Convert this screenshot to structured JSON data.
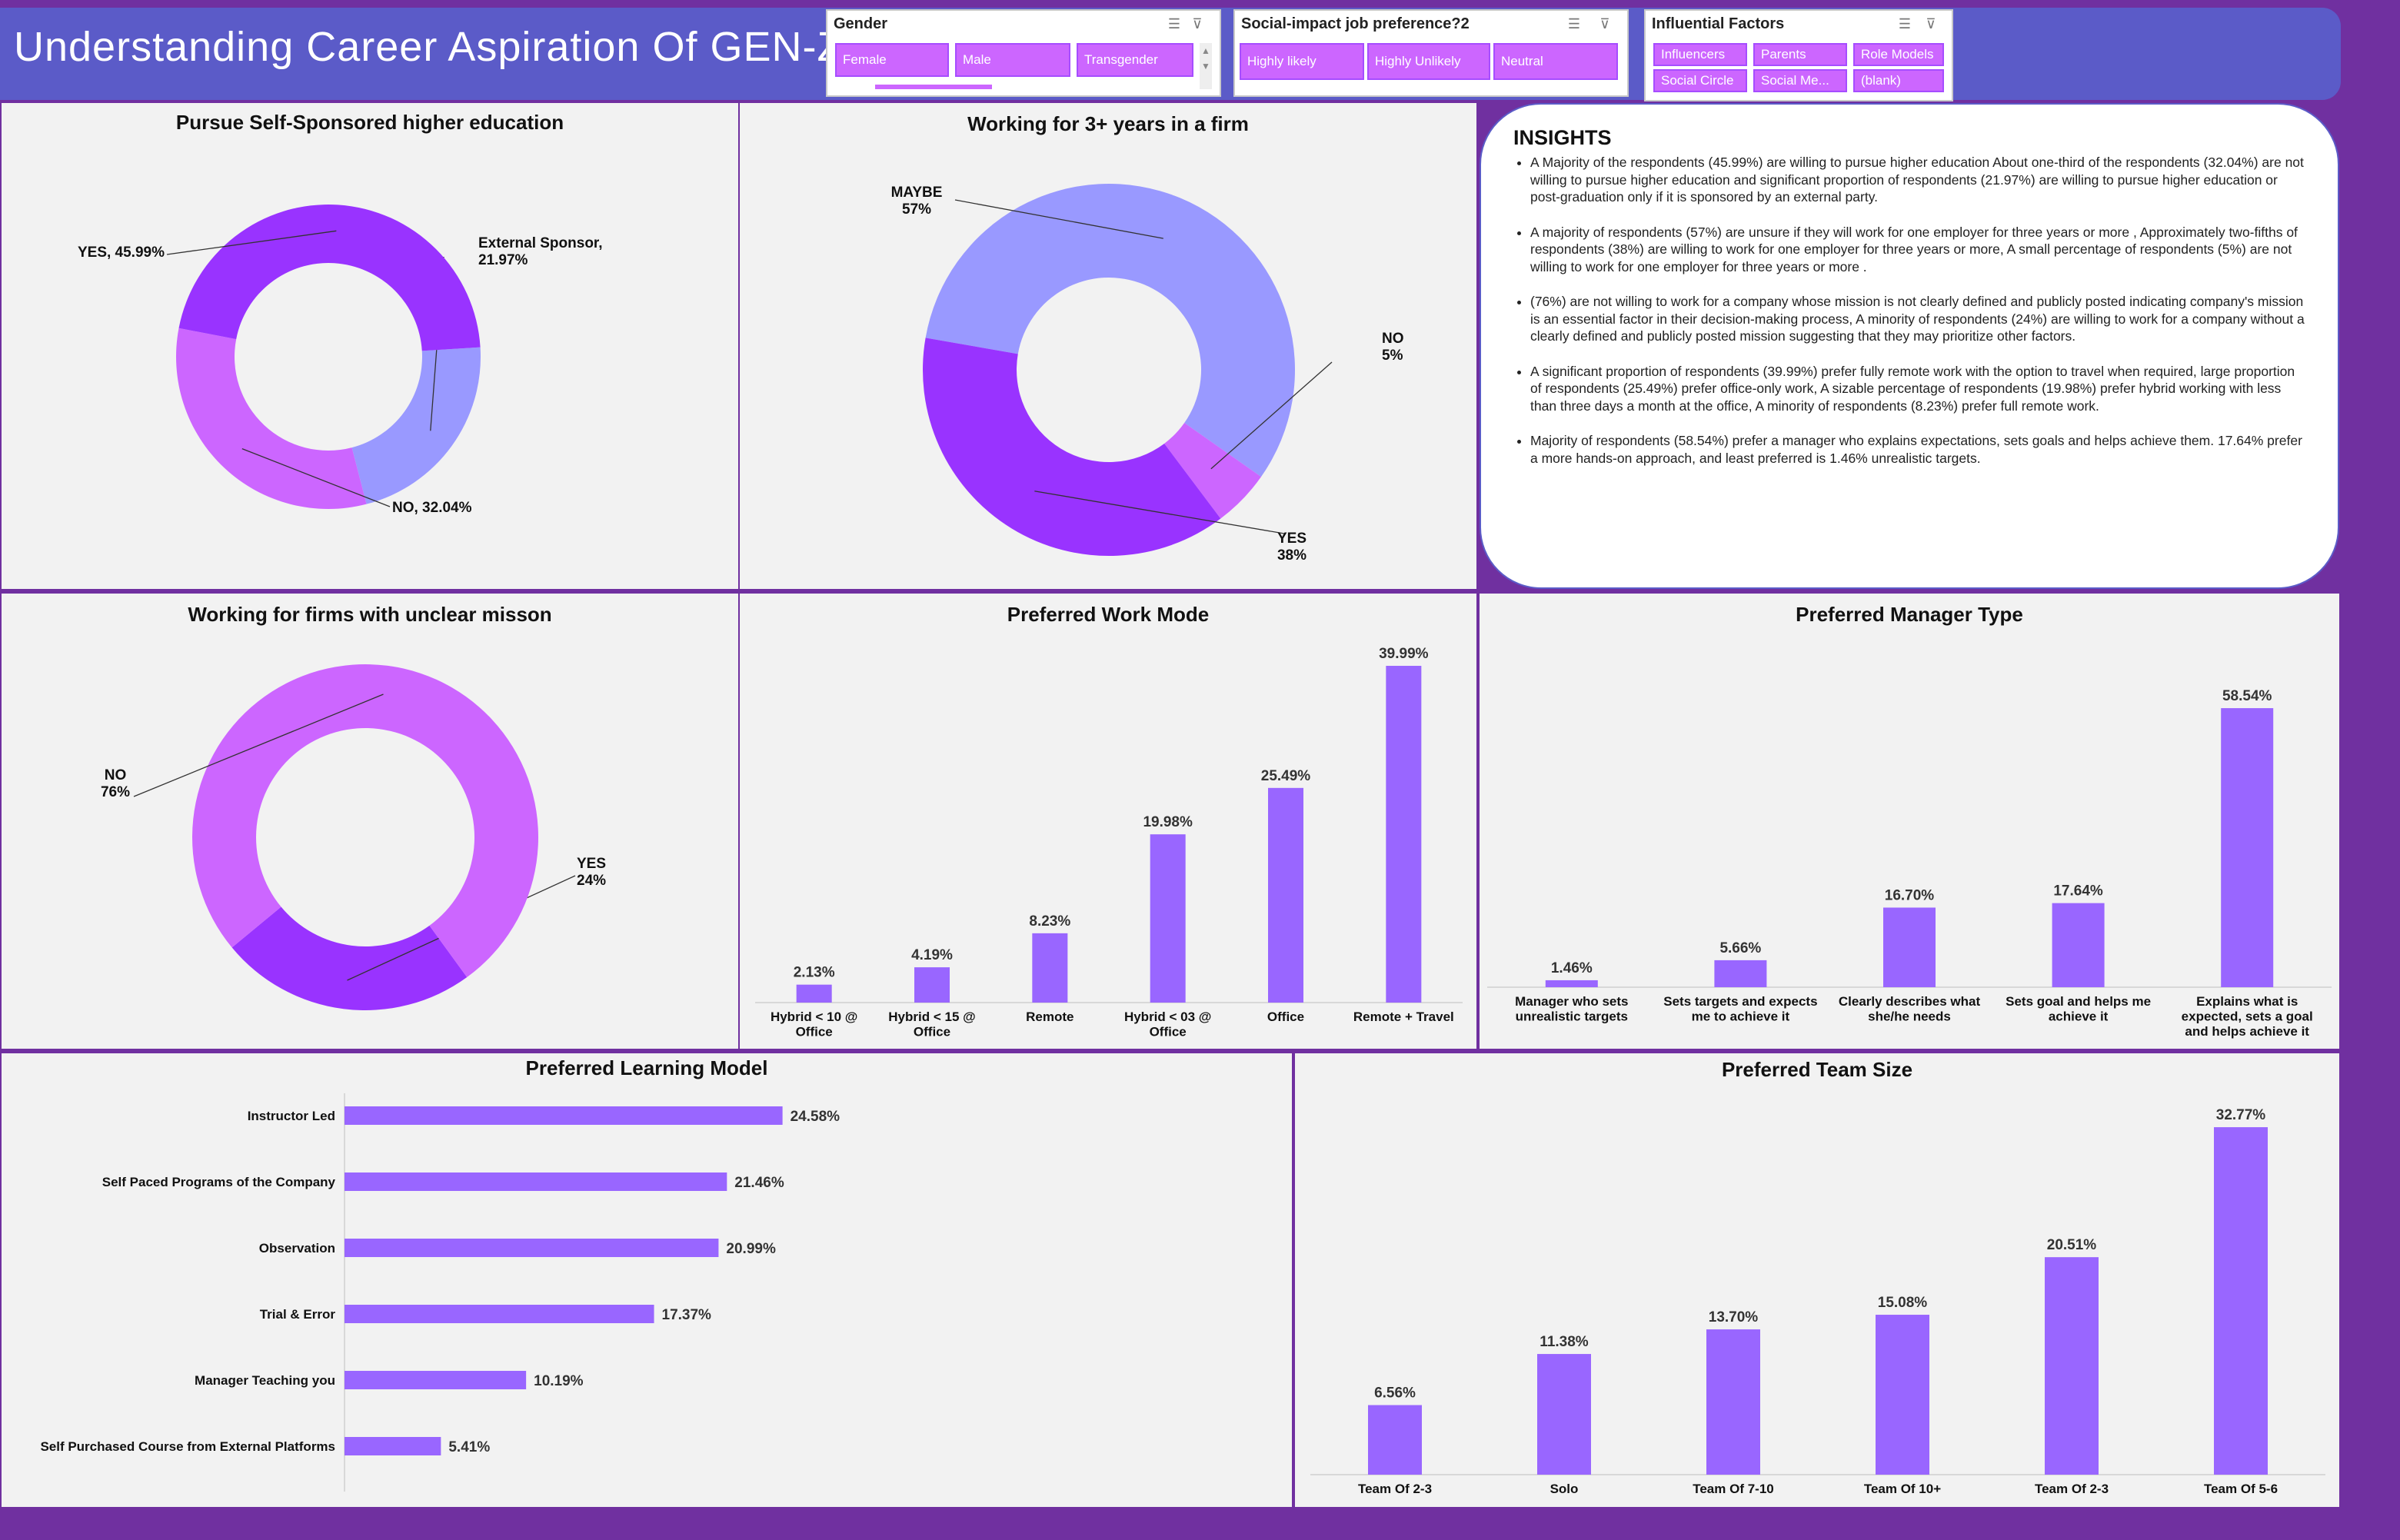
{
  "header": {
    "title": "Understanding Career Aspiration Of GEN-Z"
  },
  "slicers": {
    "gender": {
      "title": "Gender",
      "items": [
        "Female",
        "Male",
        "Transgender"
      ]
    },
    "social": {
      "title": "Social-impact job preference?2",
      "items": [
        "Highly likely",
        "Highly Unlikely",
        "Neutral"
      ]
    },
    "influence": {
      "title": "Influential Factors",
      "items": [
        "Influencers",
        "Parents",
        "Role Models",
        "Social Circle",
        "Social Me...",
        "(blank)"
      ]
    }
  },
  "insights": {
    "heading": "INSIGHTS",
    "points": [
      "A Majority of the respondents (45.99%) are willing to pursue higher education About one-third of the respondents (32.04%) are not willing to pursue higher education and significant proportion of respondents (21.97%) are willing to pursue higher education or post-graduation only if it is sponsored by an external party.",
      "A majority of respondents (57%) are unsure if they will work for one employer for three years or more , Approximately two-fifths of respondents (38%) are willing to work for one employer for three years or more, A small percentage of respondents (5%) are not willing to work for one employer for three years or more .",
      "(76%) are not willing to work for a company whose mission is not clearly defined and publicly posted indicating company's mission is an essential factor in their decision-making process, A minority of respondents (24%) are willing to work for a company without a clearly defined and publicly posted mission suggesting that they may prioritize other factors.",
      "A significant proportion of respondents (39.99%) prefer fully remote work with the option to travel when required, large proportion of respondents (25.49%) prefer office-only work, A sizable percentage of respondents (19.98%) prefer hybrid working with less than three days a month at the office, A minority of respondents (8.23%) prefer full remote work.",
      "Majority of respondents (58.54%) prefer a manager who explains expectations, sets goals and helps achieve them. 17.64% prefer a more hands-on approach, and least preferred is 1.46% unrealistic targets."
    ]
  },
  "colors": {
    "dark_purple": "#9933ff",
    "light_purple": "#cc66ff",
    "periwinkle": "#9999ff",
    "bar": "#9966ff",
    "title_bar": "#5b5bc8",
    "background": "#7030a0"
  },
  "chart_data": [
    {
      "id": "higher_ed",
      "type": "pie",
      "title": "Pursue Self-Sponsored higher education",
      "slices": [
        {
          "label": "External Sponsor",
          "value": 21.97,
          "text": "External Sponsor,\n21.97%",
          "color": "#9999ff"
        },
        {
          "label": "NO",
          "value": 32.04,
          "text": "NO, 32.04%",
          "color": "#cc66ff"
        },
        {
          "label": "YES",
          "value": 45.99,
          "text": "YES, 45.99%",
          "color": "#9933ff"
        }
      ]
    },
    {
      "id": "three_years",
      "type": "pie",
      "title": "Working for 3+ years in a firm",
      "slices": [
        {
          "label": "MAYBE",
          "value": 57,
          "text": "MAYBE\n57%",
          "color": "#9999ff"
        },
        {
          "label": "NO",
          "value": 5,
          "text": "NO\n5%",
          "color": "#cc66ff"
        },
        {
          "label": "YES",
          "value": 38,
          "text": "YES\n38%",
          "color": "#9933ff"
        }
      ]
    },
    {
      "id": "unclear_mission",
      "type": "pie",
      "title": "Working for firms with unclear misson",
      "slices": [
        {
          "label": "YES",
          "value": 24,
          "text": "YES\n24%",
          "color": "#9933ff"
        },
        {
          "label": "NO",
          "value": 76,
          "text": "NO\n76%",
          "color": "#cc66ff"
        }
      ]
    },
    {
      "id": "work_mode",
      "type": "bar",
      "title": "Preferred Work Mode",
      "categories": [
        "Hybrid < 10 @ Office",
        "Hybrid < 15 @ Office",
        "Remote",
        "Hybrid < 03 @ Office",
        "Office",
        "Remote + Travel"
      ],
      "values": [
        2.13,
        4.19,
        8.23,
        19.98,
        25.49,
        39.99
      ],
      "labels": [
        "2.13%",
        "4.19%",
        "8.23%",
        "19.98%",
        "25.49%",
        "39.99%"
      ]
    },
    {
      "id": "manager_type",
      "type": "bar",
      "title": "Preferred Manager Type",
      "categories": [
        "Manager who sets unrealistic targets",
        "Sets targets and expects me to achieve it",
        "Clearly describes what she/he needs",
        "Sets goal and helps me achieve it",
        "Explains what is expected, sets a goal and helps achieve it"
      ],
      "values": [
        1.46,
        5.66,
        16.7,
        17.64,
        58.54
      ],
      "labels": [
        "1.46%",
        "5.66%",
        "16.70%",
        "17.64%",
        "58.54%"
      ]
    },
    {
      "id": "learning_model",
      "type": "bar",
      "orientation": "horizontal",
      "title": "Preferred Learning Model",
      "categories": [
        "Instructor Led",
        "Self Paced Programs of the Company",
        "Observation",
        "Trial & Error",
        "Manager Teaching you",
        "Self Purchased Course from External Platforms"
      ],
      "values": [
        24.58,
        21.46,
        20.99,
        17.37,
        10.19,
        5.41
      ],
      "labels": [
        "24.58%",
        "21.46%",
        "20.99%",
        "17.37%",
        "10.19%",
        "5.41%"
      ]
    },
    {
      "id": "team_size",
      "type": "bar",
      "title": "Preferred Team Size",
      "categories": [
        "Team Of 2-3",
        "Solo",
        "Team Of 7-10",
        "Team Of 10+",
        "Team Of 2-3",
        "Team Of 5-6"
      ],
      "values": [
        6.56,
        11.38,
        13.7,
        15.08,
        20.51,
        32.77
      ],
      "labels": [
        "6.56%",
        "11.38%",
        "13.70%",
        "15.08%",
        "20.51%",
        "32.77%"
      ]
    }
  ]
}
